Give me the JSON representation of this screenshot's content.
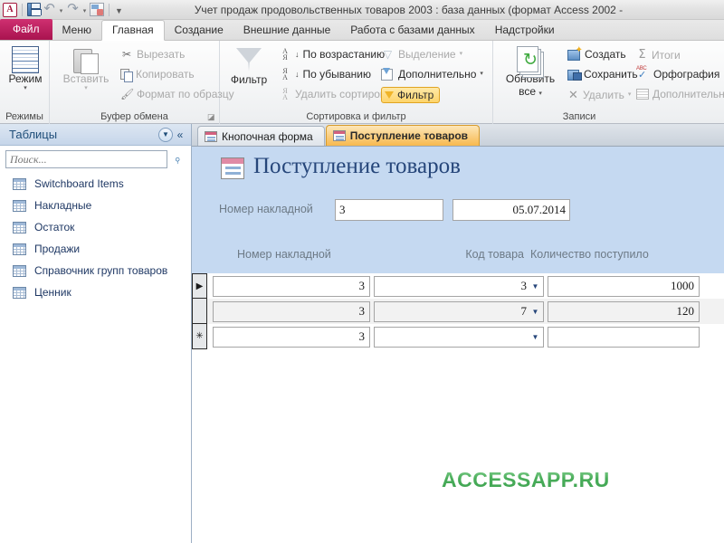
{
  "titlebar": {
    "app_icon": "access-logo-icon",
    "title": "Учет продаж продовольственных товаров 2003 : база данных (формат Access 2002 -",
    "quick_access": [
      {
        "name": "save-icon",
        "label": "Сохранить"
      },
      {
        "name": "undo-icon",
        "label": "Отменить"
      },
      {
        "name": "redo-icon",
        "label": "Вернуть"
      },
      {
        "name": "print-preview-icon",
        "label": "Предварительный просмотр"
      },
      {
        "name": "customize-qat-icon",
        "label": "Настройка панели быстрого доступа"
      }
    ],
    "undo_glyph": "↶",
    "redo_glyph": "↷",
    "caret_glyph": "▾",
    "qat_more_glyph": "▼"
  },
  "ribbon": {
    "file_tab": "Файл",
    "tabs": [
      {
        "label": "Меню",
        "active": false
      },
      {
        "label": "Главная",
        "active": true
      },
      {
        "label": "Создание",
        "active": false
      },
      {
        "label": "Внешние данные",
        "active": false
      },
      {
        "label": "Работа с базами данных",
        "active": false
      },
      {
        "label": "Надстройки",
        "active": false
      }
    ],
    "groups": [
      {
        "name": "views",
        "label": "Режимы"
      },
      {
        "name": "clipboard",
        "label": "Буфер обмена"
      },
      {
        "name": "sort-filter",
        "label": "Сортировка и фильтр"
      },
      {
        "name": "records",
        "label": "Записи"
      }
    ],
    "views": {
      "button_label": "Режим",
      "caret": "▾"
    },
    "clipboard": {
      "paste_label": "Вставить",
      "paste_caret": "▾",
      "cut_label": "Вырезать",
      "copy_label": "Копировать",
      "format_painter_label": "Формат по образцу",
      "cut_glyph": "✂",
      "brush_glyph": "🖌",
      "launcher_glyph": "◪"
    },
    "sort_filter": {
      "filter_big_label": "Фильтр",
      "asc_label": "По возрастанию",
      "desc_label": "По убыванию",
      "clear_sort_label": "Удалить сортировку",
      "selection_label": "Выделение",
      "selection_caret": "▾",
      "advanced_label": "Дополнительно",
      "advanced_caret": "▾",
      "toggle_filter_label": "Фильтр",
      "asc_a": "А",
      "asc_b": "Я",
      "desc_a": "Я",
      "desc_b": "А",
      "arrow_glyph": "↓"
    },
    "records": {
      "refresh_label_1": "Обновить",
      "refresh_label_2": "все",
      "refresh_caret": "▾",
      "new_label": "Создать",
      "save_label": "Сохранить",
      "delete_label": "Удалить",
      "delete_caret": "▾",
      "totals_label": "Итоги",
      "spelling_label": "Орфография",
      "more_label": "Дополнительно",
      "delete_glyph": "✕",
      "sigma_glyph": "Σ"
    }
  },
  "navpane": {
    "title": "Таблицы",
    "dropdown_glyph": "▼",
    "collapse_glyph": "«",
    "search_placeholder": "Поиск...",
    "search_value": "",
    "search_icon_glyph": "⌕",
    "items": [
      {
        "label": "Switchboard Items",
        "icon": "table-icon"
      },
      {
        "label": "Накладные",
        "icon": "table-icon"
      },
      {
        "label": "Остаток",
        "icon": "table-icon"
      },
      {
        "label": "Продажи",
        "icon": "table-icon"
      },
      {
        "label": "Справочник групп товаров",
        "icon": "table-icon"
      },
      {
        "label": "Ценник",
        "icon": "table-icon"
      }
    ]
  },
  "doctabs": [
    {
      "label": "Кнопочная форма",
      "active": false,
      "icon": "form-icon"
    },
    {
      "label": "Поступление товаров",
      "active": true,
      "icon": "form-icon"
    }
  ],
  "form": {
    "title": "Поступление товаров",
    "title_icon": "form-icon",
    "invoice_label": "Номер накладной",
    "invoice_value": "3",
    "date_value": "05.07.2014",
    "subform": {
      "columns": [
        "Номер накладной",
        "Код товара",
        "Количество поступило"
      ],
      "combo_caret": "▼",
      "current_row_glyph": "▶",
      "new_row_glyph": "✳",
      "rows": [
        {
          "marker": "current",
          "invoice": "3",
          "product_code": "3",
          "quantity": "1000"
        },
        {
          "marker": "none",
          "invoice": "3",
          "product_code": "7",
          "quantity": "120"
        },
        {
          "marker": "new",
          "invoice": "3",
          "product_code": "",
          "quantity": ""
        }
      ]
    }
  },
  "watermark": {
    "text": "ACCESSAPP.RU",
    "color": "#3aa64c"
  },
  "colors": {
    "accent_magenta": "#a9134f",
    "form_header_bg": "#c5d9f1",
    "active_doc_tab": "#f7b94e",
    "nav_text": "#1f3864"
  }
}
